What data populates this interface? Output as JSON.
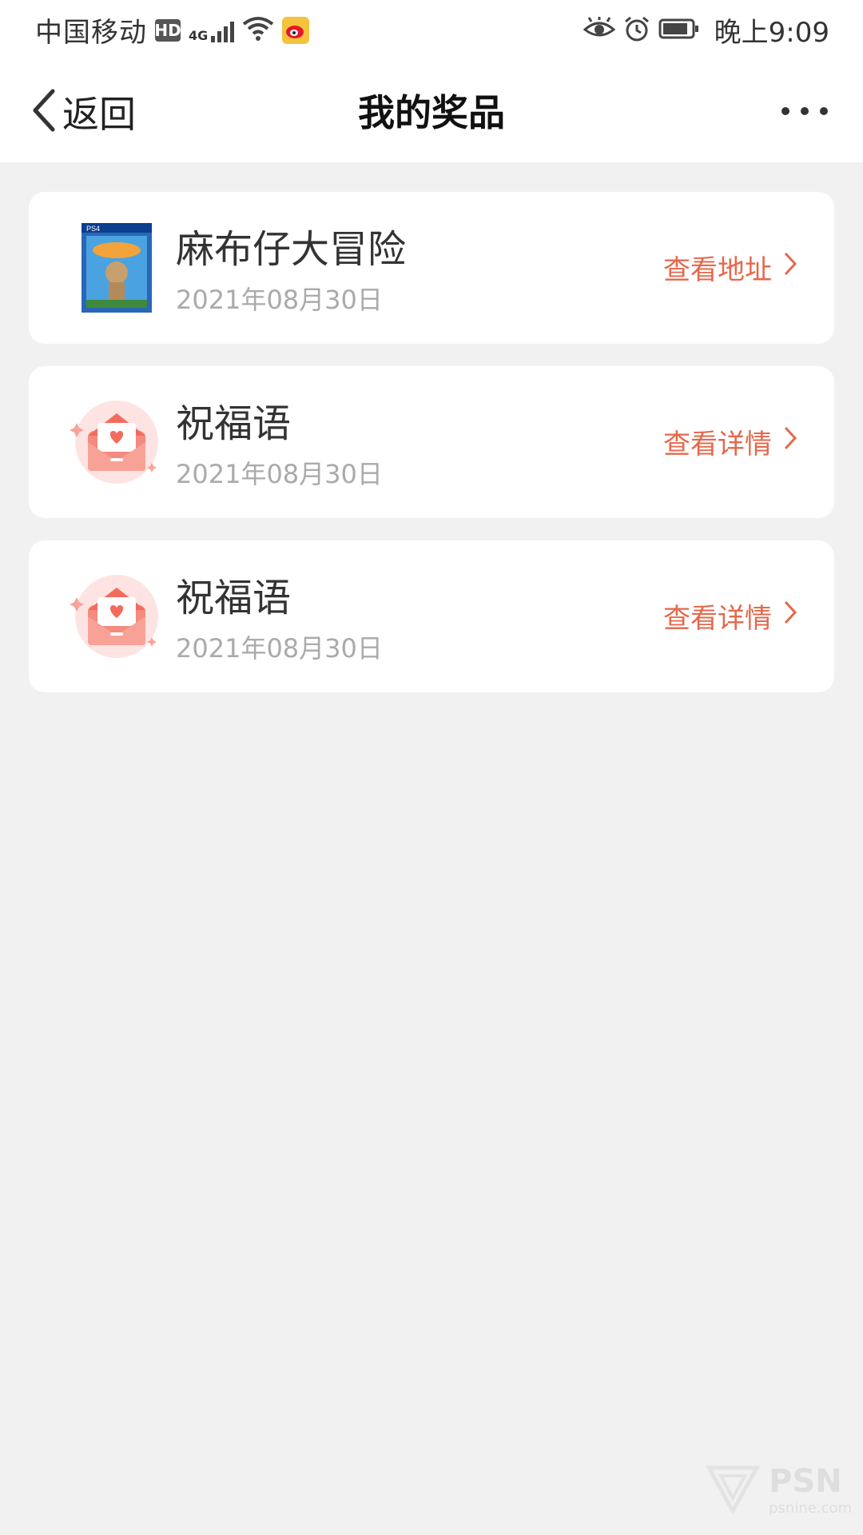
{
  "status_bar": {
    "carrier": "中国移动",
    "hd": "HD",
    "network": "4G",
    "time": "晚上9:09"
  },
  "nav": {
    "back_label": "返回",
    "title": "我的奖品"
  },
  "prizes": [
    {
      "title": "麻布仔大冒险",
      "date": "2021年08月30日",
      "action": "查看地址",
      "icon": "game-cover-icon"
    },
    {
      "title": "祝福语",
      "date": "2021年08月30日",
      "action": "查看详情",
      "icon": "envelope-heart-icon"
    },
    {
      "title": "祝福语",
      "date": "2021年08月30日",
      "action": "查看详情",
      "icon": "envelope-heart-icon"
    }
  ],
  "watermark": {
    "text": "PSN",
    "sub": "psnine.com"
  },
  "colors": {
    "accent": "#e4684c",
    "background": "#f1f1f1",
    "card": "#ffffff"
  }
}
